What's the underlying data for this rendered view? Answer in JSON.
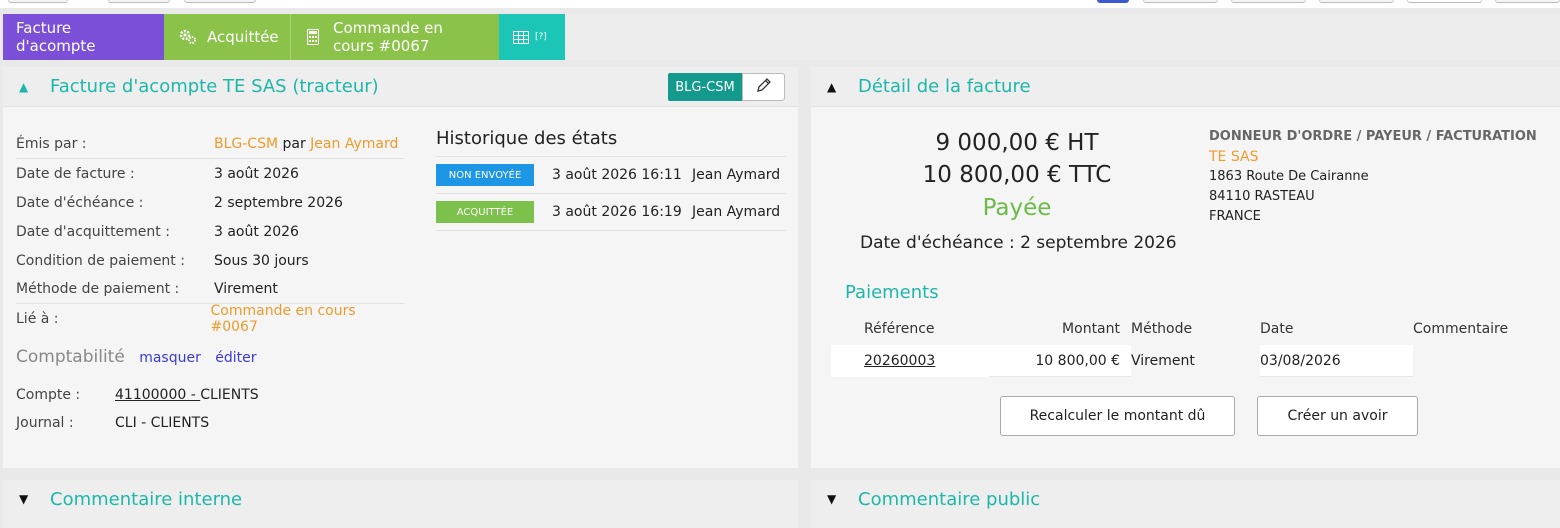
{
  "tabs": [
    {
      "label": "Facture d'acompte"
    },
    {
      "label": "Acquittée"
    },
    {
      "label": "Commande en cours #0067"
    },
    {
      "label": "[?]"
    }
  ],
  "left_panel": {
    "title": "Facture d'acompte TE SAS (tracteur)",
    "badge": "BLG-CSM",
    "rows": [
      {
        "label": "Émis par :",
        "value_link": "BLG-CSM",
        "value_mid": " par ",
        "value_link2": "Jean Aymard"
      },
      {
        "label": "Date de facture :",
        "value": "3 août 2026"
      },
      {
        "label": "Date d'échéance :",
        "value": "2 septembre 2026"
      },
      {
        "label": "Date d'acquittement :",
        "value": "3 août 2026"
      },
      {
        "label": "Condition de paiement :",
        "value": "Sous 30 jours"
      },
      {
        "label": "Méthode de paiement :",
        "value": "Virement"
      },
      {
        "label": "Lié à :",
        "value_link": "Commande en cours #0067"
      }
    ],
    "history": {
      "title": "Historique des états",
      "rows": [
        {
          "status": "NON ENVOYÉE",
          "date": "3 août 2026 16:11",
          "user": "Jean Aymard"
        },
        {
          "status": "ACQUITTÉE",
          "date": "3 août 2026 16:19",
          "user": "Jean Aymard"
        }
      ]
    },
    "comptabilite": {
      "title": "Comptabilité",
      "hide": "masquer",
      "edit": "éditer",
      "compte_label": "Compte :",
      "compte_link": "41100000 - ",
      "compte_rest": "CLIENTS",
      "journal_label": "Journal :",
      "journal_value": "CLI - CLIENTS"
    }
  },
  "right_panel": {
    "title": "Détail de la facture",
    "amount_ht": "9 000,00 € HT",
    "amount_ttc": "10 800,00 € TTC",
    "status": "Payée",
    "due": "Date d'échéance : 2 septembre 2026",
    "donneur": {
      "heading": "DONNEUR D'ORDRE / PAYEUR / FACTURATION",
      "name": "TE SAS",
      "addr1": "1863 Route De Cairanne",
      "addr2": "84110 RASTEAU",
      "addr3": "FRANCE"
    },
    "payments_title": "Paiements",
    "columns": [
      "Référence",
      "Montant",
      "Méthode",
      "Date",
      "Commentaire"
    ],
    "payments": [
      {
        "ref": "20260003",
        "amount": "10 800,00 €",
        "method": "Virement",
        "date": "03/08/2026",
        "comment": ""
      }
    ],
    "btn_recalc": "Recalculer le montant dû",
    "btn_avoir": "Créer un avoir"
  },
  "bottom": {
    "internal": "Commentaire interne",
    "public": "Commentaire public"
  },
  "colors": {
    "purple": "#7b4fd8",
    "green": "#8bc34a",
    "teal": "#1bc6b6",
    "orange": "#ef9a2c",
    "paid": "#6cba48"
  }
}
